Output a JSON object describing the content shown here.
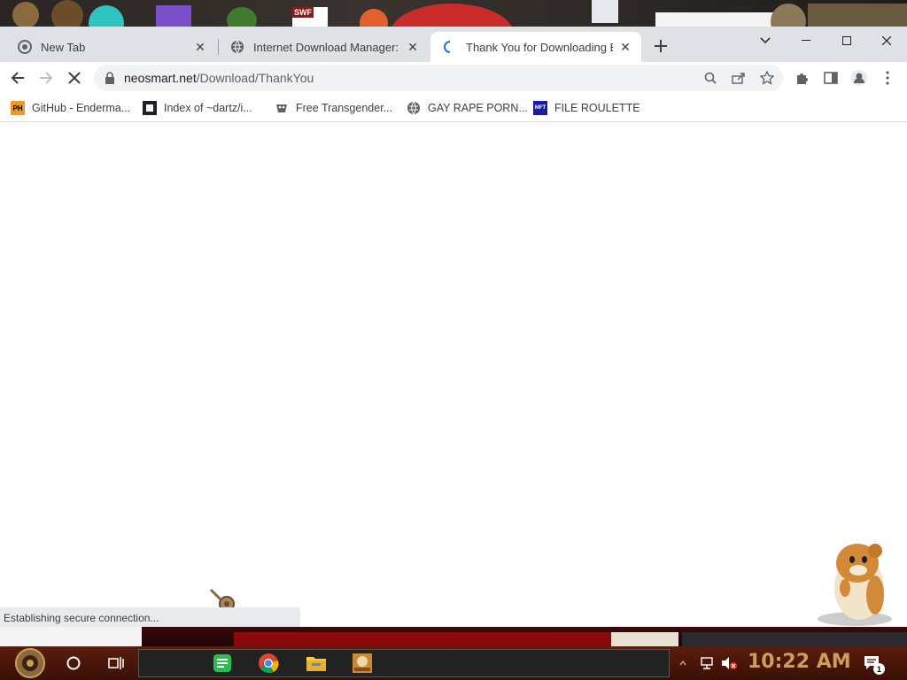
{
  "browser": {
    "tabs": [
      {
        "title": "New Tab",
        "active": false
      },
      {
        "title": "Internet Download Manager: Th",
        "active": false
      },
      {
        "title": "Thank You for Downloading Eas",
        "active": true
      }
    ],
    "url_host": "neosmart.net",
    "url_path": "/Download/ThankYou",
    "bookmarks": [
      {
        "label": "GitHub - Enderma...",
        "icon": "PH"
      },
      {
        "label": "Index of ~dartz/i...",
        "icon": "film-icon"
      },
      {
        "label": "Free Transgender...",
        "icon": "mask-icon"
      },
      {
        "label": "GAY RAPE PORN...",
        "icon": "globe-icon"
      },
      {
        "label": "FILE ROULETTE",
        "icon": "MFT"
      }
    ],
    "status_text": "Establishing secure connection..."
  },
  "taskbar": {
    "clock": "10:22 AM",
    "notification_count": "1"
  },
  "colors": {
    "tabstrip": "#dee1e6",
    "omnibox": "#f1f3f4",
    "taskbar": "#5a1d0d",
    "clock": "#c9a05a"
  }
}
